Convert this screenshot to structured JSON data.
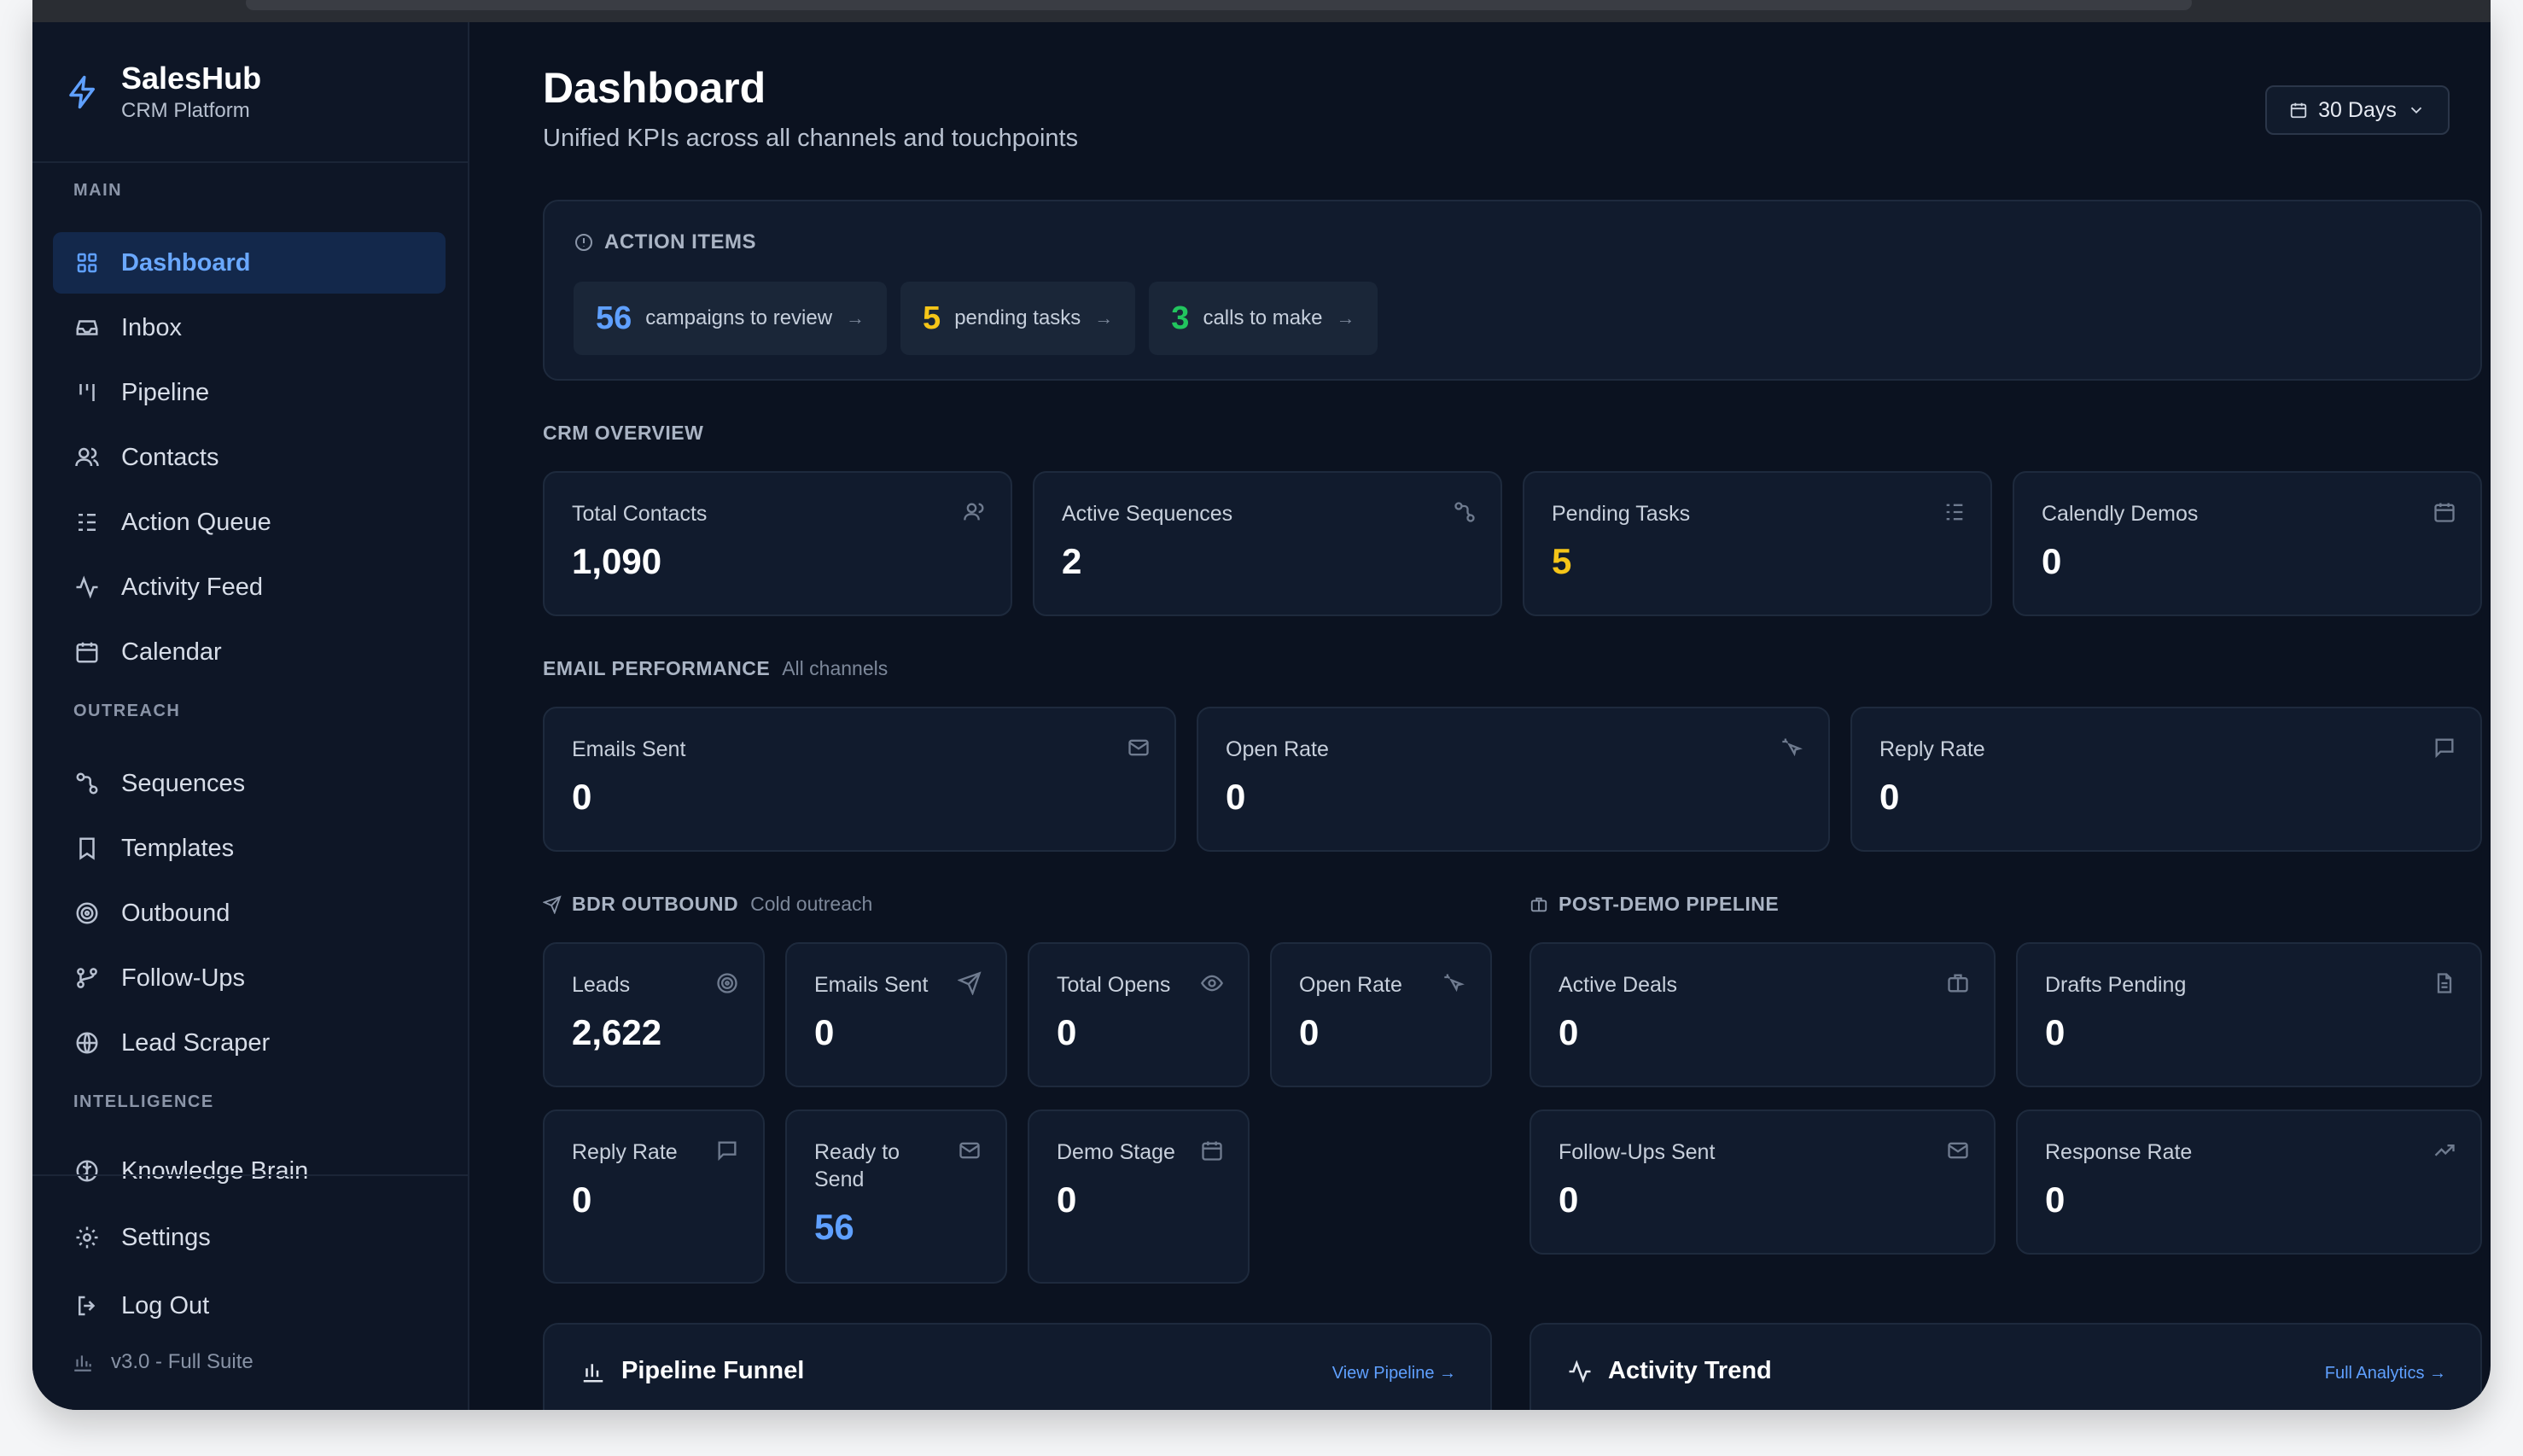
{
  "brand": {
    "name": "SalesHub",
    "subtitle": "CRM Platform"
  },
  "sidebar": {
    "sections": {
      "main": "MAIN",
      "outreach": "OUTREACH",
      "intelligence": "INTELLIGENCE"
    },
    "items": {
      "dashboard": "Dashboard",
      "inbox": "Inbox",
      "pipeline": "Pipeline",
      "contacts": "Contacts",
      "action_queue": "Action Queue",
      "activity_feed": "Activity Feed",
      "calendar": "Calendar",
      "sequences": "Sequences",
      "templates": "Templates",
      "outbound": "Outbound",
      "follow_ups": "Follow-Ups",
      "lead_scraper": "Lead Scraper",
      "knowledge_brain": "Knowledge Brain",
      "settings": "Settings",
      "log_out": "Log Out"
    },
    "version": "v3.0 - Full Suite"
  },
  "header": {
    "title": "Dashboard",
    "subtitle": "Unified KPIs across all channels and touchpoints",
    "range": "30 Days"
  },
  "action_items": {
    "title": "ACTION ITEMS",
    "chips": [
      {
        "num": "56",
        "text": "campaigns to review",
        "color": "#5fa0ff"
      },
      {
        "num": "5",
        "text": "pending tasks",
        "color": "#f5c518"
      },
      {
        "num": "3",
        "text": "calls to make",
        "color": "#22c55e"
      }
    ]
  },
  "crm_overview": {
    "title": "CRM OVERVIEW",
    "cards": [
      {
        "label": "Total Contacts",
        "value": "1,090",
        "icon": "users-icon"
      },
      {
        "label": "Active Sequences",
        "value": "2",
        "icon": "workflow-icon"
      },
      {
        "label": "Pending Tasks",
        "value": "5",
        "icon": "list-icon",
        "color": "#f5c518"
      },
      {
        "label": "Calendly Demos",
        "value": "0",
        "icon": "calendar-icon"
      }
    ]
  },
  "email_performance": {
    "title": "EMAIL PERFORMANCE",
    "muted": "All channels",
    "cards": [
      {
        "label": "Emails Sent",
        "value": "0",
        "icon": "mail-icon"
      },
      {
        "label": "Open Rate",
        "value": "0",
        "icon": "click-icon"
      },
      {
        "label": "Reply Rate",
        "value": "0",
        "icon": "message-icon"
      }
    ]
  },
  "bdr_outbound": {
    "title": "BDR OUTBOUND",
    "muted": "Cold outreach",
    "cards": [
      {
        "label": "Leads",
        "value": "2,622",
        "icon": "target-icon"
      },
      {
        "label": "Emails Sent",
        "value": "0",
        "icon": "send-icon"
      },
      {
        "label": "Total Opens",
        "value": "0",
        "icon": "eye-icon"
      },
      {
        "label": "Open Rate",
        "value": "0",
        "icon": "click-icon"
      },
      {
        "label": "Reply Rate",
        "value": "0",
        "icon": "message-icon"
      },
      {
        "label": "Ready to Send",
        "value": "56",
        "icon": "mail-icon",
        "color": "#5fa0ff"
      },
      {
        "label": "Demo Stage",
        "value": "0",
        "icon": "calendar-icon"
      }
    ]
  },
  "post_demo": {
    "title": "POST-DEMO PIPELINE",
    "cards": [
      {
        "label": "Active Deals",
        "value": "0",
        "icon": "briefcase-icon"
      },
      {
        "label": "Drafts Pending",
        "value": "0",
        "icon": "file-icon"
      },
      {
        "label": "Follow-Ups Sent",
        "value": "0",
        "icon": "mail-icon"
      },
      {
        "label": "Response Rate",
        "value": "0",
        "icon": "trend-up-icon"
      }
    ]
  },
  "pipeline_funnel": {
    "title": "Pipeline Funnel",
    "link": "View Pipeline →"
  },
  "activity_trend": {
    "title": "Activity Trend",
    "link": "Full Analytics →"
  }
}
